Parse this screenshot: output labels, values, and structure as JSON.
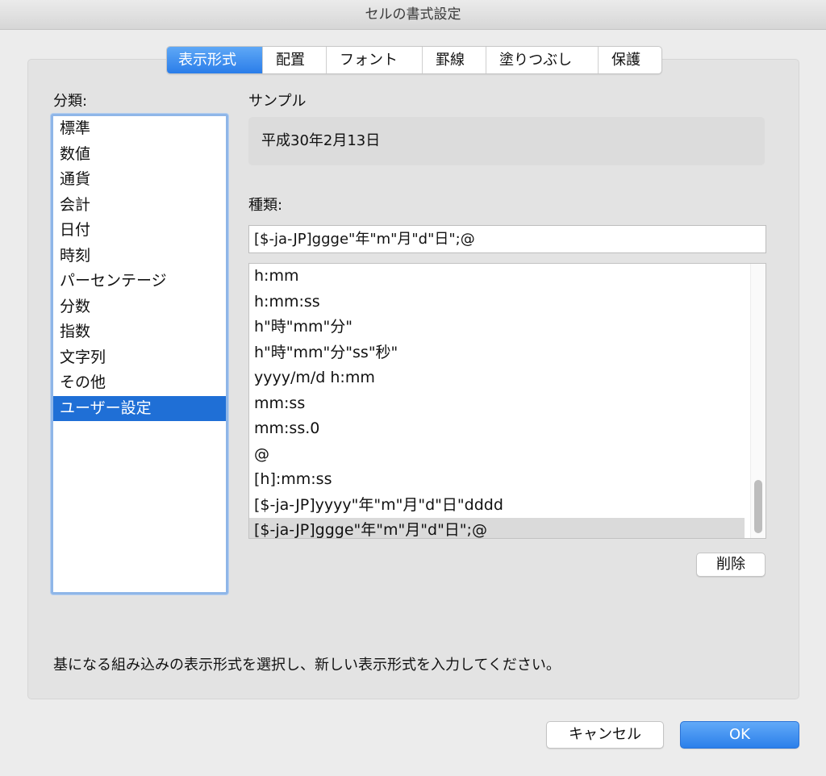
{
  "window": {
    "title": "セルの書式設定"
  },
  "tabs": [
    {
      "label": "表示形式",
      "active": true
    },
    {
      "label": "配置",
      "active": false
    },
    {
      "label": "フォント",
      "active": false
    },
    {
      "label": "罫線",
      "active": false
    },
    {
      "label": "塗りつぶし",
      "active": false
    },
    {
      "label": "保護",
      "active": false
    }
  ],
  "category": {
    "label": "分類:",
    "selected_index": 11,
    "items": [
      "標準",
      "数値",
      "通貨",
      "会計",
      "日付",
      "時刻",
      "パーセンテージ",
      "分数",
      "指数",
      "文字列",
      "その他",
      "ユーザー設定"
    ]
  },
  "sample": {
    "label": "サンプル",
    "value": "平成30年2月13日"
  },
  "type": {
    "label": "種類:",
    "input_value": "[$-ja-JP]ggge\"年\"m\"月\"d\"日\";@",
    "selected_index": 10,
    "items": [
      "h:mm",
      "h:mm:ss",
      "h\"時\"mm\"分\"",
      "h\"時\"mm\"分\"ss\"秒\"",
      "yyyy/m/d h:mm",
      "mm:ss",
      "mm:ss.0",
      "@",
      "[h]:mm:ss",
      "[$-ja-JP]yyyy\"年\"m\"月\"d\"日\"dddd",
      "[$-ja-JP]ggge\"年\"m\"月\"d\"日\";@"
    ]
  },
  "buttons": {
    "delete": "削除",
    "cancel": "キャンセル",
    "ok": "OK"
  },
  "hint": "基になる組み込みの表示形式を選択し、新しい表示形式を入力してください。",
  "colors": {
    "accent": "#2a7de9",
    "selection": "#1f6fd6"
  }
}
